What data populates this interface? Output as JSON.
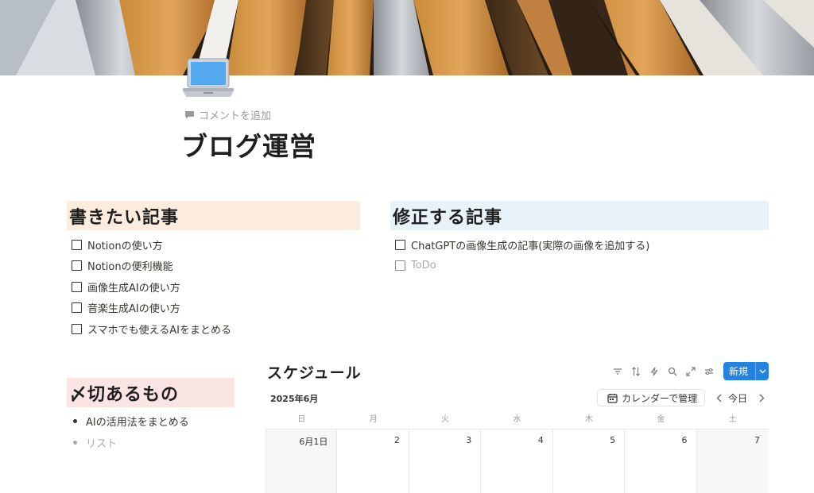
{
  "page": {
    "icon": "laptop-icon",
    "comment_label": "コメントを追加",
    "title": "ブログ運営"
  },
  "sections": {
    "want_to_write": {
      "heading": "書きたい記事",
      "color": "#fbecdd",
      "items": [
        {
          "label": "Notionの使い方",
          "checked": false
        },
        {
          "label": "Notionの便利機能",
          "checked": false
        },
        {
          "label": "画像生成AIの使い方",
          "checked": false
        },
        {
          "label": "音楽生成AIの使い方",
          "checked": false
        },
        {
          "label": "スマホでも使えるAIをまとめる",
          "checked": false
        }
      ]
    },
    "to_fix": {
      "heading": "修正する記事",
      "color": "#e7f3f8",
      "items": [
        {
          "label": "ChatGPTの画像生成の記事(実際の画像を追加する)",
          "checked": false
        }
      ],
      "placeholder": "ToDo"
    },
    "deadlines": {
      "heading": "〆切あるもの",
      "color": "#fbe4e4",
      "items": [
        "AIの活用法をまとめる"
      ],
      "placeholder": "リスト"
    }
  },
  "calendar": {
    "title": "スケジュール",
    "toolbar_icons": [
      "filter-icon",
      "sort-icon",
      "automation-icon",
      "search-icon",
      "expand-icon",
      "settings-icon"
    ],
    "new_button": "新規",
    "month": "2025年6月",
    "manage_button": "カレンダーで管理",
    "today_label": "今日",
    "weekdays": [
      "日",
      "月",
      "火",
      "水",
      "木",
      "金",
      "土"
    ],
    "days": [
      "6月1日",
      "2",
      "3",
      "4",
      "5",
      "6",
      "7"
    ],
    "accent_color": "#2383e2"
  }
}
